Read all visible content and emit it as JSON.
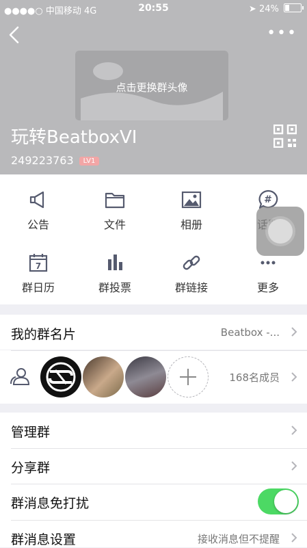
{
  "status_bar": {
    "signal": "●●●●○",
    "carrier": "中国移动",
    "network": "4G",
    "time": "20:55",
    "battery": "24%"
  },
  "header": {
    "avatar_hint": "点击更换群头像",
    "group_name": "玩转BeatboxVI",
    "group_id": "249223763",
    "level_badge": "LV1"
  },
  "actions": [
    {
      "label": "公告",
      "icon": "megaphone-icon"
    },
    {
      "label": "文件",
      "icon": "folder-icon"
    },
    {
      "label": "相册",
      "icon": "photo-album-icon"
    },
    {
      "label": "话题",
      "icon": "topic-bubble-icon"
    },
    {
      "label": "群日历",
      "icon": "calendar-icon"
    },
    {
      "label": "群投票",
      "icon": "vote-bars-icon"
    },
    {
      "label": "群链接",
      "icon": "link-icon"
    },
    {
      "label": "更多",
      "icon": "more-dots-icon"
    }
  ],
  "calendar_day": "7",
  "group_card": {
    "label": "我的群名片",
    "value": "Beatbox  -..."
  },
  "members": {
    "count_label": "168名成员"
  },
  "settings": [
    {
      "label": "管理群"
    },
    {
      "label": "分享群"
    },
    {
      "label": "群消息免打扰",
      "toggle_on": true
    },
    {
      "label": "群消息设置",
      "value": "接收消息但不提醒"
    }
  ],
  "colors": {
    "toggle_on": "#4cd964",
    "badge": "#f2a6a6",
    "header_bg": "#b9b9bb"
  }
}
